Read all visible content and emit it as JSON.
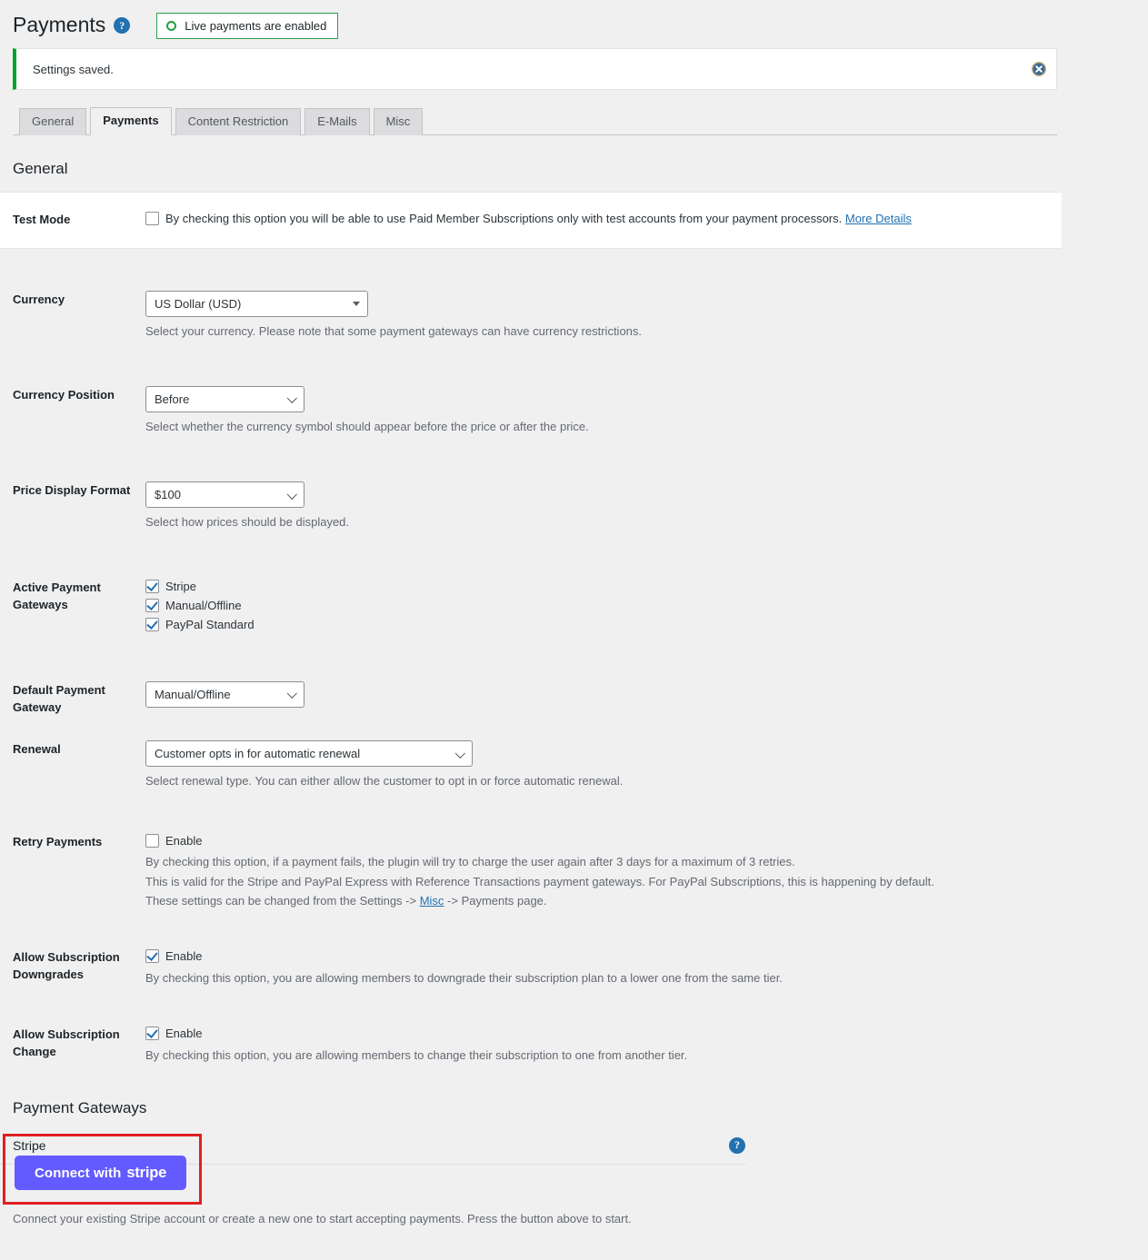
{
  "header": {
    "title": "Payments",
    "help_icon": "question-mark-icon",
    "live_badge": {
      "label": "Live payments are enabled",
      "icon": "circle-ring-icon",
      "border_color": "#2e9e4f"
    }
  },
  "notice": {
    "text": "Settings saved.",
    "accent_color": "#00a32a",
    "dismiss_icon": "close-circle-icon"
  },
  "tabs": [
    {
      "label": "General",
      "active": false
    },
    {
      "label": "Payments",
      "active": true
    },
    {
      "label": "Content Restriction",
      "active": false
    },
    {
      "label": "E-Mails",
      "active": false
    },
    {
      "label": "Misc",
      "active": false
    }
  ],
  "sections": {
    "general_title": "General",
    "gateways_title": "Payment Gateways"
  },
  "fields": {
    "test_mode": {
      "label": "Test Mode",
      "checkbox_label_pre": "By checking this option you will be able to use Paid Member Subscriptions only with test accounts from your payment processors.",
      "link_label": "More Details",
      "checked": false
    },
    "currency": {
      "label": "Currency",
      "value": "US Dollar (USD)",
      "description": "Select your currency. Please note that some payment gateways can have currency restrictions."
    },
    "currency_position": {
      "label": "Currency Position",
      "value": "Before",
      "description": "Select whether the currency symbol should appear before the price or after the price."
    },
    "price_display_format": {
      "label": "Price Display Format",
      "value": "$100",
      "description": "Select how prices should be displayed."
    },
    "active_payment_gateways": {
      "label": "Active Payment Gateways",
      "options": [
        {
          "label": "Stripe",
          "checked": true
        },
        {
          "label": "Manual/Offline",
          "checked": true
        },
        {
          "label": "PayPal Standard",
          "checked": true
        }
      ]
    },
    "default_payment_gateway": {
      "label": "Default Payment Gateway",
      "value": "Manual/Offline"
    },
    "renewal": {
      "label": "Renewal",
      "value": "Customer opts in for automatic renewal",
      "description": "Select renewal type. You can either allow the customer to opt in or force automatic renewal."
    },
    "retry_payments": {
      "label": "Retry Payments",
      "checkbox_label": "Enable",
      "checked": false,
      "description_line1": "By checking this option, if a payment fails, the plugin will try to charge the user again after 3 days for a maximum of 3 retries.",
      "description_line2": "This is valid for the Stripe and PayPal Express with Reference Transactions payment gateways. For PayPal Subscriptions, this is happening by default.",
      "description_line3_pre": "These settings can be changed from the Settings -> ",
      "description_line3_link": "Misc",
      "description_line3_post": " -> Payments page."
    },
    "allow_subscription_downgrades": {
      "label": "Allow Subscription Downgrades",
      "checkbox_label": "Enable",
      "checked": true,
      "description": "By checking this option, you are allowing members to downgrade their subscription plan to a lower one from the same tier."
    },
    "allow_subscription_change": {
      "label": "Allow Subscription Change",
      "checkbox_label": "Enable",
      "checked": true,
      "description": "By checking this option, you are allowing members to change their subscription to one from another tier."
    }
  },
  "stripe": {
    "gateway_name": "Stripe",
    "help_icon": "question-mark-icon",
    "connect_button_prefix": "Connect with",
    "connect_button_wordmark": "stripe",
    "button_color": "#635bff",
    "note": "Connect your existing Stripe account or create a new one to start accepting payments. Press the button above to start.",
    "highlight_color": "#e02020"
  }
}
